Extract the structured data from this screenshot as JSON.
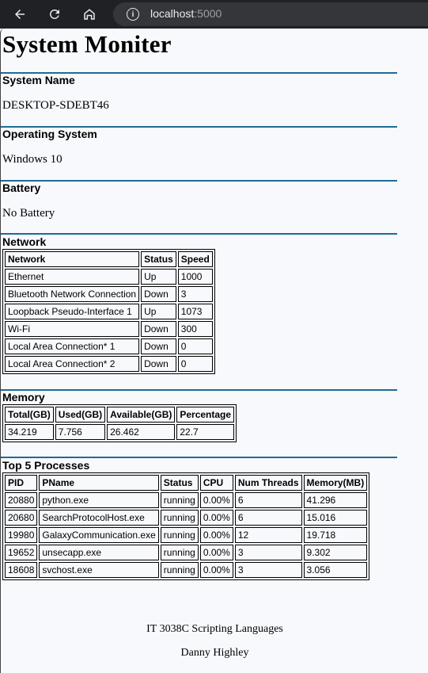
{
  "browser": {
    "url_host": "localhost",
    "url_port": ":5000"
  },
  "page": {
    "title": "System Moniter"
  },
  "system_name": {
    "label": "System Name",
    "value": "DESKTOP-SDEBT46"
  },
  "operating_system": {
    "label": "Operating System",
    "value": "Windows 10"
  },
  "battery": {
    "label": "Battery",
    "value": "No Battery"
  },
  "network": {
    "label": "Network",
    "headers": [
      "Network",
      "Status",
      "Speed"
    ],
    "rows": [
      [
        "Ethernet",
        "Up",
        "1000"
      ],
      [
        "Bluetooth Network Connection",
        "Down",
        "3"
      ],
      [
        "Loopback Pseudo-Interface 1",
        "Up",
        "1073"
      ],
      [
        "Wi-Fi",
        "Down",
        "300"
      ],
      [
        "Local Area Connection* 1",
        "Down",
        "0"
      ],
      [
        "Local Area Connection* 2",
        "Down",
        "0"
      ]
    ]
  },
  "memory": {
    "label": "Memory",
    "headers": [
      "Total(GB)",
      "Used(GB)",
      "Available(GB)",
      "Percentage"
    ],
    "rows": [
      [
        "34.219",
        "7.756",
        "26.462",
        "22.7"
      ]
    ]
  },
  "processes": {
    "label": "Top 5 Processes",
    "headers": [
      "PID",
      "PName",
      "Status",
      "CPU",
      "Num Threads",
      "Memory(MB)"
    ],
    "rows": [
      [
        "20880",
        "python.exe",
        "running",
        "0.00%",
        "6",
        "41.296"
      ],
      [
        "20680",
        "SearchProtocolHost.exe",
        "running",
        "0.00%",
        "6",
        "15.016"
      ],
      [
        "19980",
        "GalaxyCommunication.exe",
        "running",
        "0.00%",
        "12",
        "19.718"
      ],
      [
        "19652",
        "unsecapp.exe",
        "running",
        "0.00%",
        "3",
        "9.302"
      ],
      [
        "18608",
        "svchost.exe",
        "running",
        "0.00%",
        "3",
        "3.056"
      ]
    ]
  },
  "footer": {
    "course": "IT 3038C Scripting Languages",
    "author": "Danny Highley"
  }
}
